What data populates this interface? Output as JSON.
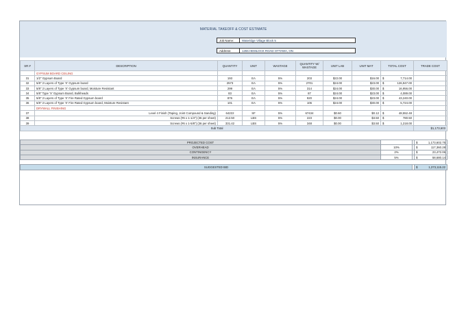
{
  "title": "MATERIAL TAKEOFF & COST ESTIMATE",
  "job": {
    "label": "Job Name:",
    "value": "Waterldge Village Block 5"
  },
  "address": {
    "label": "Address:",
    "value": "1255 HEMLOCK ROAD OTTAWA, ON"
  },
  "columns": [
    "SR #",
    "DESCRIPTION",
    "QUANTITY",
    "UNIT",
    "WASTAGE",
    "QUANTITY W/ WASTAGE",
    "UNIT LAB",
    "UNIT MAT",
    "TOTAL COST",
    "TRADE COST"
  ],
  "categories": {
    "cat1": "GYPSUM BOARD CEILING",
    "cat2": "DRYWALL FINISHING"
  },
  "rows": [
    {
      "sr": "31",
      "desc": "1/2\" Gypsum Board",
      "qty": "193",
      "unit": "EA",
      "waste": "5%",
      "qtyw": "203",
      "lab": "$22.00",
      "mat": "$16.00",
      "cur": "$",
      "total": "7,714.00"
    },
    {
      "sr": "32",
      "desc": "5/8\" 2 Layers of Type 'X' Gypsum board",
      "qty": "2573",
      "unit": "EA",
      "waste": "5%",
      "qtyw": "2701",
      "lab": "$24.00",
      "mat": "$23.00",
      "cur": "$",
      "total": "126,947.00"
    },
    {
      "sr": "33",
      "desc": "5/8\" 2 Layers of Type 'X' Gypsum board, Moisture Resistant",
      "qty": "299",
      "unit": "EA",
      "waste": "5%",
      "qtyw": "314",
      "lab": "$24.00",
      "mat": "$30.00",
      "cur": "$",
      "total": "16,956.00"
    },
    {
      "sr": "34",
      "desc": "5/8\" Type 'X' Gypsum Board, Bulkheads",
      "qty": "83",
      "unit": "EA",
      "waste": "5%",
      "qtyw": "87",
      "lab": "$24.00",
      "mat": "$23.00",
      "cur": "$",
      "total": "4,089.00"
    },
    {
      "sr": "35",
      "desc": "5/8\" 2 Layers of Type 'X' Fire Rated Gypsum board",
      "qty": "876",
      "unit": "EA",
      "waste": "5%",
      "qtyw": "920",
      "lab": "$24.00",
      "mat": "$23.00",
      "cur": "$",
      "total": "43,240.00"
    },
    {
      "sr": "36",
      "desc": "5/8\" 2 Layers of Type 'X' Fire Rated Gypsum board, Moisture Resistant",
      "qty": "101",
      "unit": "EA",
      "waste": "5%",
      "qtyw": "106",
      "lab": "$24.00",
      "mat": "$30.00",
      "cur": "$",
      "total": "5,724.00"
    },
    {
      "sr": "37",
      "desc": "Level 4 Finish (Taping, Joint Compound & Sanding)",
      "qty": "64222",
      "unit": "SF",
      "waste": "5%",
      "qtyw": "67434",
      "lab": "$0.60",
      "mat": "$0.12",
      "cur": "$",
      "total": "48,552.48"
    },
    {
      "sr": "38",
      "desc": "Screws (#6 x 1-1/4\") (36 per sheet)",
      "qty": "212.50",
      "unit": "LBS",
      "waste": "5%",
      "qtyw": "223",
      "lab": "$0.00",
      "mat": "$3.50",
      "cur": "$",
      "total": "780.50"
    },
    {
      "sr": "39",
      "desc": "Screws (#6 x 1-5/8\") (36 per sheet)",
      "qty": "331.42",
      "unit": "LBS",
      "waste": "5%",
      "qtyw": "348",
      "lab": "$0.00",
      "mat": "$3.50",
      "cur": "$",
      "total": "1,218.00"
    }
  ],
  "subtotal": {
    "label": "Sub Total",
    "value": "$1,173,603"
  },
  "summary": {
    "projected": {
      "label": "PROJECTED COST",
      "pct": "",
      "cur": "$",
      "value": "1,173,602.75"
    },
    "overhead": {
      "label": "OVERHEAD",
      "pct": "10%",
      "cur": "$",
      "value": "117,360.28"
    },
    "contingency": {
      "label": "CONTINGENCY",
      "pct": "2%",
      "cur": "$",
      "value": "23,472.06"
    },
    "insurance": {
      "label": "INSURANCE",
      "pct": "5%",
      "cur": "$",
      "value": "58,680.14"
    },
    "bid": {
      "label": "SUGGESTED BID",
      "cur": "$",
      "value": "1,373,115.22"
    }
  }
}
